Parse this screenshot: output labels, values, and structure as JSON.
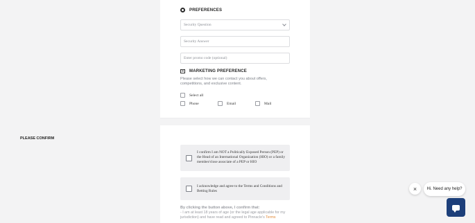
{
  "preferences": {
    "title": "PREFERENCES",
    "security_question_placeholder": "Security Question",
    "security_answer_placeholder": "Security Answer",
    "promo_placeholder": "Enter promo code (optional)"
  },
  "marketing": {
    "title": "MARKETING PREFERENCE",
    "description": "Please select how we can contact you about offers, competitions, and exclusive content.",
    "select_all": "Select all",
    "options": [
      "Phone",
      "Email",
      "Mail"
    ]
  },
  "confirm": {
    "title": "PLEASE CONFIRM",
    "pep_text": "I confirm I am NOT a Politically Exposed Person (PEP) or the Head of an International Organization (HIO) or a family member/close associate of a PEP or HIO",
    "terms_text": "I acknowledge and agree to the Terms and Conditions and Betting Rules"
  },
  "legal": {
    "heading": "By clicking the button above, I confirm that:",
    "line1": "- I am at least 18 years of age (or the legal age applicable for my jurisdiction) and have read and agreed to Pinnacle's",
    "link": "Terms"
  },
  "chat": {
    "close": "×",
    "prompt": "Hi. Need any help?"
  },
  "colors": {
    "page_bg": "#f3f3f4",
    "chat_button": "#1d3f7a",
    "link": "#e08a3a"
  }
}
